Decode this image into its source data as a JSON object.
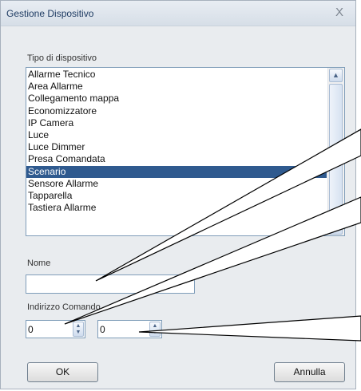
{
  "dialog": {
    "title": "Gestione Dispositivo",
    "close_glyph": "X"
  },
  "device_type": {
    "label": "Tipo di dispositivo",
    "items": [
      "Allarme Tecnico",
      "Area Allarme",
      "Collegamento mappa",
      "Economizzatore",
      "IP Camera",
      "Luce",
      "Luce Dimmer",
      "Presa Comandata",
      "Scenario",
      "Sensore Allarme",
      "Tapparella",
      "Tastiera Allarme"
    ],
    "selected": "Scenario"
  },
  "name_field": {
    "label": "Nome",
    "value": ""
  },
  "command_address": {
    "label": "Indirizzo Comando",
    "first_value": "0",
    "second_value": "0"
  },
  "buttons": {
    "ok": "OK",
    "cancel": "Annulla"
  },
  "icons": {
    "scroll_up": "chevron-up-icon",
    "scroll_down": "chevron-down-icon",
    "spin_up": "triangle-up-icon",
    "spin_down": "triangle-down-icon"
  },
  "colors": {
    "selection": "#2f5a8f",
    "title_text": "#1f3c63",
    "dialog_bg": "#e9ecef"
  }
}
